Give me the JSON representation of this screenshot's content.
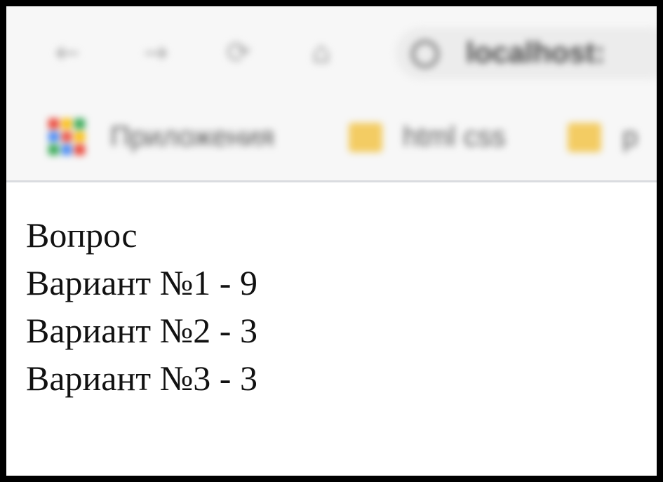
{
  "browser": {
    "nav_icons": {
      "back": "←",
      "forward": "→",
      "reload": "⟳",
      "home": "⌂"
    },
    "address": "localhost:"
  },
  "bookmarks": [
    {
      "label": "Приложения"
    },
    {
      "label": "html css"
    },
    {
      "label": "p"
    }
  ],
  "page": {
    "question": "Вопрос",
    "options": [
      "Вариант №1 - 9",
      "Вариант №2 - 3",
      "Вариант №3 - 3"
    ]
  },
  "colors": {
    "frame": "#000000",
    "toolbar": "#f7f7f7",
    "folder": "#f3cc63",
    "text": "#111111"
  }
}
